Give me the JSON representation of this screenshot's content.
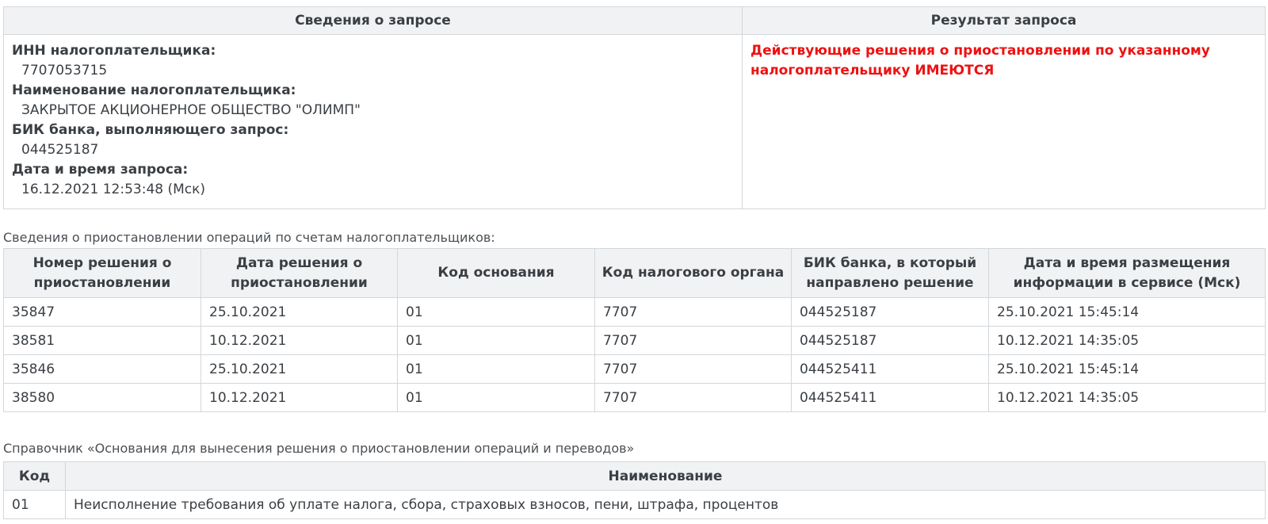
{
  "request_info": {
    "header_left": "Сведения о запросе",
    "header_right": "Результат запроса",
    "fields": [
      {
        "label": "ИНН налогоплательщика:",
        "value": "7707053715"
      },
      {
        "label": "Наименование налогоплательщика:",
        "value": "ЗАКРЫТОЕ АКЦИОНЕРНОЕ ОБЩЕСТВО \"ОЛИМП\""
      },
      {
        "label": "БИК банка, выполняющего запрос:",
        "value": "044525187"
      },
      {
        "label": "Дата и время запроса:",
        "value": "16.12.2021 12:53:48 (Мск)"
      }
    ],
    "result_line1": "Действующие решения о приостановлении по указанному",
    "result_line2": "налогоплательщику ИМЕЮТСЯ",
    "result_color": "#ee1111"
  },
  "suspensions": {
    "caption": "Сведения о приостановлении операций по счетам налогоплательщиков:",
    "headers": [
      [
        "Номер решения о",
        "приостановлении"
      ],
      [
        "Дата решения о",
        "приостановлении"
      ],
      [
        "Код основания",
        ""
      ],
      [
        "Код налогового органа",
        ""
      ],
      [
        "БИК банка, в который",
        "направлено решение"
      ],
      [
        "Дата и время размещения",
        "информации в сервисе (Мск)"
      ]
    ],
    "rows": [
      [
        "35847",
        "25.10.2021",
        "01",
        "7707",
        "044525187",
        "25.10.2021 15:45:14"
      ],
      [
        "38581",
        "10.12.2021",
        "01",
        "7707",
        "044525187",
        "10.12.2021 14:35:05"
      ],
      [
        "35846",
        "25.10.2021",
        "01",
        "7707",
        "044525411",
        "25.10.2021 15:45:14"
      ],
      [
        "38580",
        "10.12.2021",
        "01",
        "7707",
        "044525411",
        "10.12.2021 14:35:05"
      ]
    ]
  },
  "reference": {
    "caption": "Справочник «Основания для вынесения решения о приостановлении операций и переводов»",
    "headers": [
      "Код",
      "Наименование"
    ],
    "rows": [
      [
        "01",
        "Неисполнение требования об уплате налога, сбора, страховых взносов, пени, штрафа, процентов"
      ]
    ]
  }
}
